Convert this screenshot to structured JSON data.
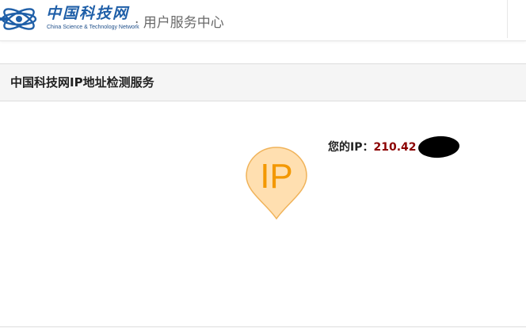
{
  "header": {
    "logo_cn": "中国科技网",
    "logo_en": "China Science & Technology Network",
    "title": "· 用户服务中心"
  },
  "section": {
    "title": "中国科技网IP地址检测服务"
  },
  "ip": {
    "label": "您的IP：",
    "value": "210.42",
    "pin_text": "IP"
  },
  "colors": {
    "brand_blue": "#1f5fa8",
    "ip_value": "#8b0000",
    "pin_fill": "#ffdfb0",
    "pin_text": "#f39800"
  },
  "icons": {
    "logo": "atom-orbit-emblem",
    "ip_marker": "map-pin-icon"
  }
}
